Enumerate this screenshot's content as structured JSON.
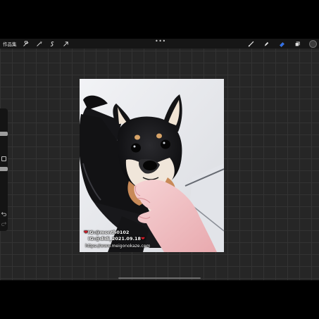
{
  "toolbar": {
    "gallery_label": "作品集",
    "left_tools": [
      "wrench-icon",
      "magic-wand-icon",
      "selection-icon",
      "transform-arrow-icon"
    ],
    "more_label": "•••",
    "right_tools": [
      "brush-icon",
      "smudge-icon",
      "eraser-icon",
      "layers-icon",
      "color-picker"
    ],
    "active_tool": "eraser-icon",
    "active_color": "#2f6fe8",
    "current_color": "#3b3b3b"
  },
  "sidebar": {
    "controls": [
      "brush-size-slider",
      "modify-button",
      "opacity-slider",
      "undo-icon",
      "redo-icon"
    ]
  },
  "canvas": {
    "subject": "black shiba inu puppy with a hand under its chin",
    "watermark": {
      "line1": "IG:@month0102",
      "line2": "IG:@didi_2021.09.18",
      "line3": "https://www.meigonokaze.com",
      "heart": "❤"
    }
  }
}
